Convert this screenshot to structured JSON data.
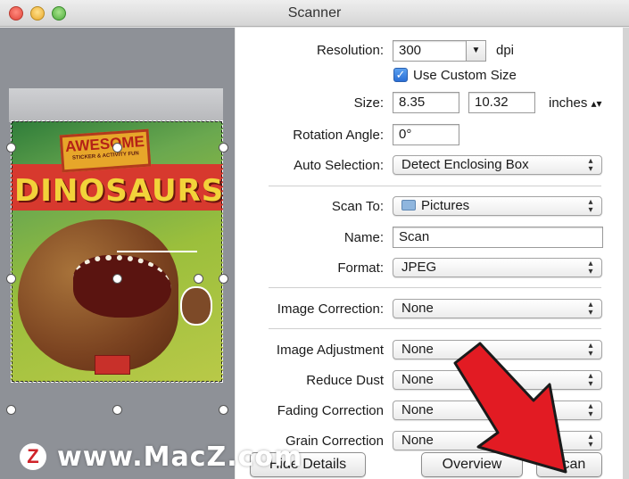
{
  "window": {
    "title": "Scanner"
  },
  "settings": {
    "resolution": {
      "label": "Resolution:",
      "value": "300",
      "unit": "dpi"
    },
    "custom_size": {
      "label": "Use Custom Size",
      "checked": true
    },
    "size": {
      "label": "Size:",
      "width": "8.35",
      "height": "10.32",
      "unit": "inches"
    },
    "rotation": {
      "label": "Rotation Angle:",
      "value": "0°"
    },
    "auto_selection": {
      "label": "Auto Selection:",
      "value": "Detect Enclosing Box"
    },
    "scan_to": {
      "label": "Scan To:",
      "value": "Pictures",
      "icon": "folder-icon"
    },
    "name": {
      "label": "Name:",
      "value": "Scan"
    },
    "format": {
      "label": "Format:",
      "value": "JPEG"
    },
    "image_correction": {
      "label": "Image Correction:",
      "value": "None"
    },
    "image_adjustment": {
      "label": "Image Adjustment",
      "value": "None"
    },
    "reduce_dust": {
      "label": "Reduce Dust",
      "value": "None"
    },
    "fading_correction": {
      "label": "Fading Correction",
      "value": "None"
    },
    "grain_correction": {
      "label": "Grain Correction",
      "value": "None"
    }
  },
  "buttons": {
    "hide_details": "Hide Details",
    "overview": "Overview",
    "scan": "Scan"
  },
  "preview": {
    "cover_badge": "AWESOME",
    "cover_subtitle": "STICKER & ACTIVITY FUN",
    "cover_title": "DINOSAURS"
  },
  "watermark": {
    "logo": "Z",
    "text": "www.MacZ.com"
  },
  "colors": {
    "arrow": "#e21b23",
    "accent": "#2a6fd6"
  }
}
